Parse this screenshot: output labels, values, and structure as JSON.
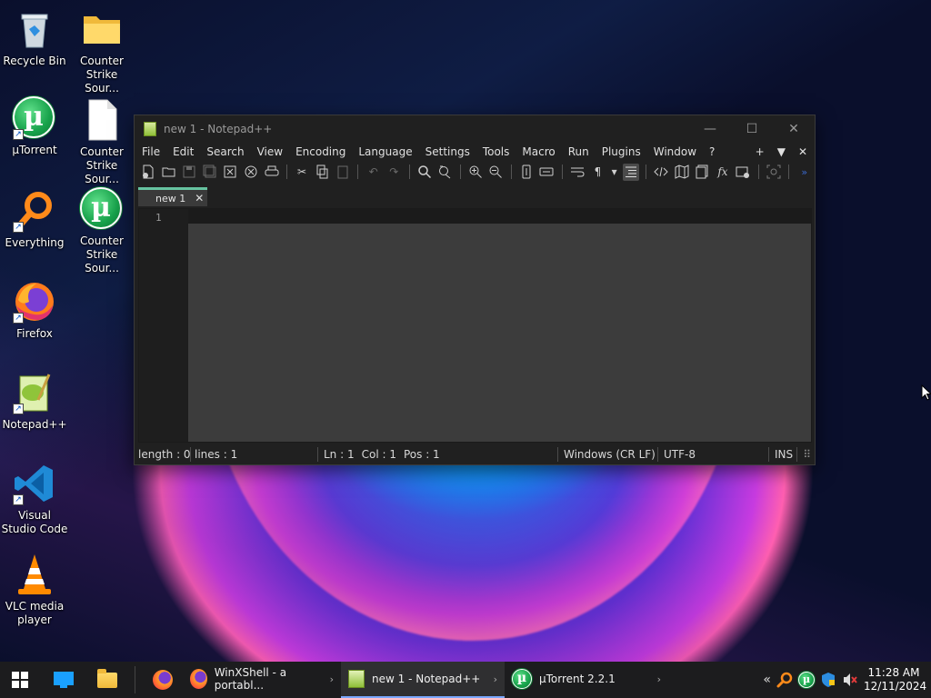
{
  "desktop": {
    "icons": [
      {
        "label": "Recycle Bin",
        "icon": "recycle-bin-icon"
      },
      {
        "label": "Counter Strike Sour...",
        "icon": "folder-icon"
      },
      {
        "label": "µTorrent",
        "icon": "utorrent-icon"
      },
      {
        "label": "Counter Strike Sour...",
        "icon": "file-icon"
      },
      {
        "label": "Everything",
        "icon": "everything-search-icon"
      },
      {
        "label": "Counter Strike Sour...",
        "icon": "utorrent-icon"
      },
      {
        "label": "Firefox",
        "icon": "firefox-icon"
      },
      {
        "label": "Notepad++",
        "icon": "notepadpp-icon"
      },
      {
        "label": "Visual Studio Code",
        "icon": "vscode-icon"
      },
      {
        "label": "VLC media player",
        "icon": "vlc-icon"
      }
    ]
  },
  "notepad": {
    "title": "new 1 - Notepad++",
    "menu": [
      "File",
      "Edit",
      "Search",
      "View",
      "Encoding",
      "Language",
      "Settings",
      "Tools",
      "Macro",
      "Run",
      "Plugins",
      "Window",
      "?"
    ],
    "menu_right": [
      "+",
      "▼",
      "✕"
    ],
    "tab": {
      "label": "new 1",
      "close": "✕"
    },
    "line_number": "1",
    "status": {
      "length": "length : 0",
      "lines": "lines : 1",
      "ln": "Ln : 1",
      "col": "Col : 1",
      "pos": "Pos : 1",
      "eol": "Windows (CR LF)",
      "encoding": "UTF-8",
      "mode": "INS"
    }
  },
  "taskbar": {
    "tasks": [
      {
        "label": "WinXShell - a portabl...",
        "icon": "firefox-icon"
      },
      {
        "label": "new 1 - Notepad++",
        "icon": "notepadpp-icon"
      },
      {
        "label": "µTorrent 2.2.1",
        "icon": "utorrent-icon"
      }
    ],
    "clock": {
      "time": "11:28 AM",
      "date": "12/11/2024"
    }
  }
}
